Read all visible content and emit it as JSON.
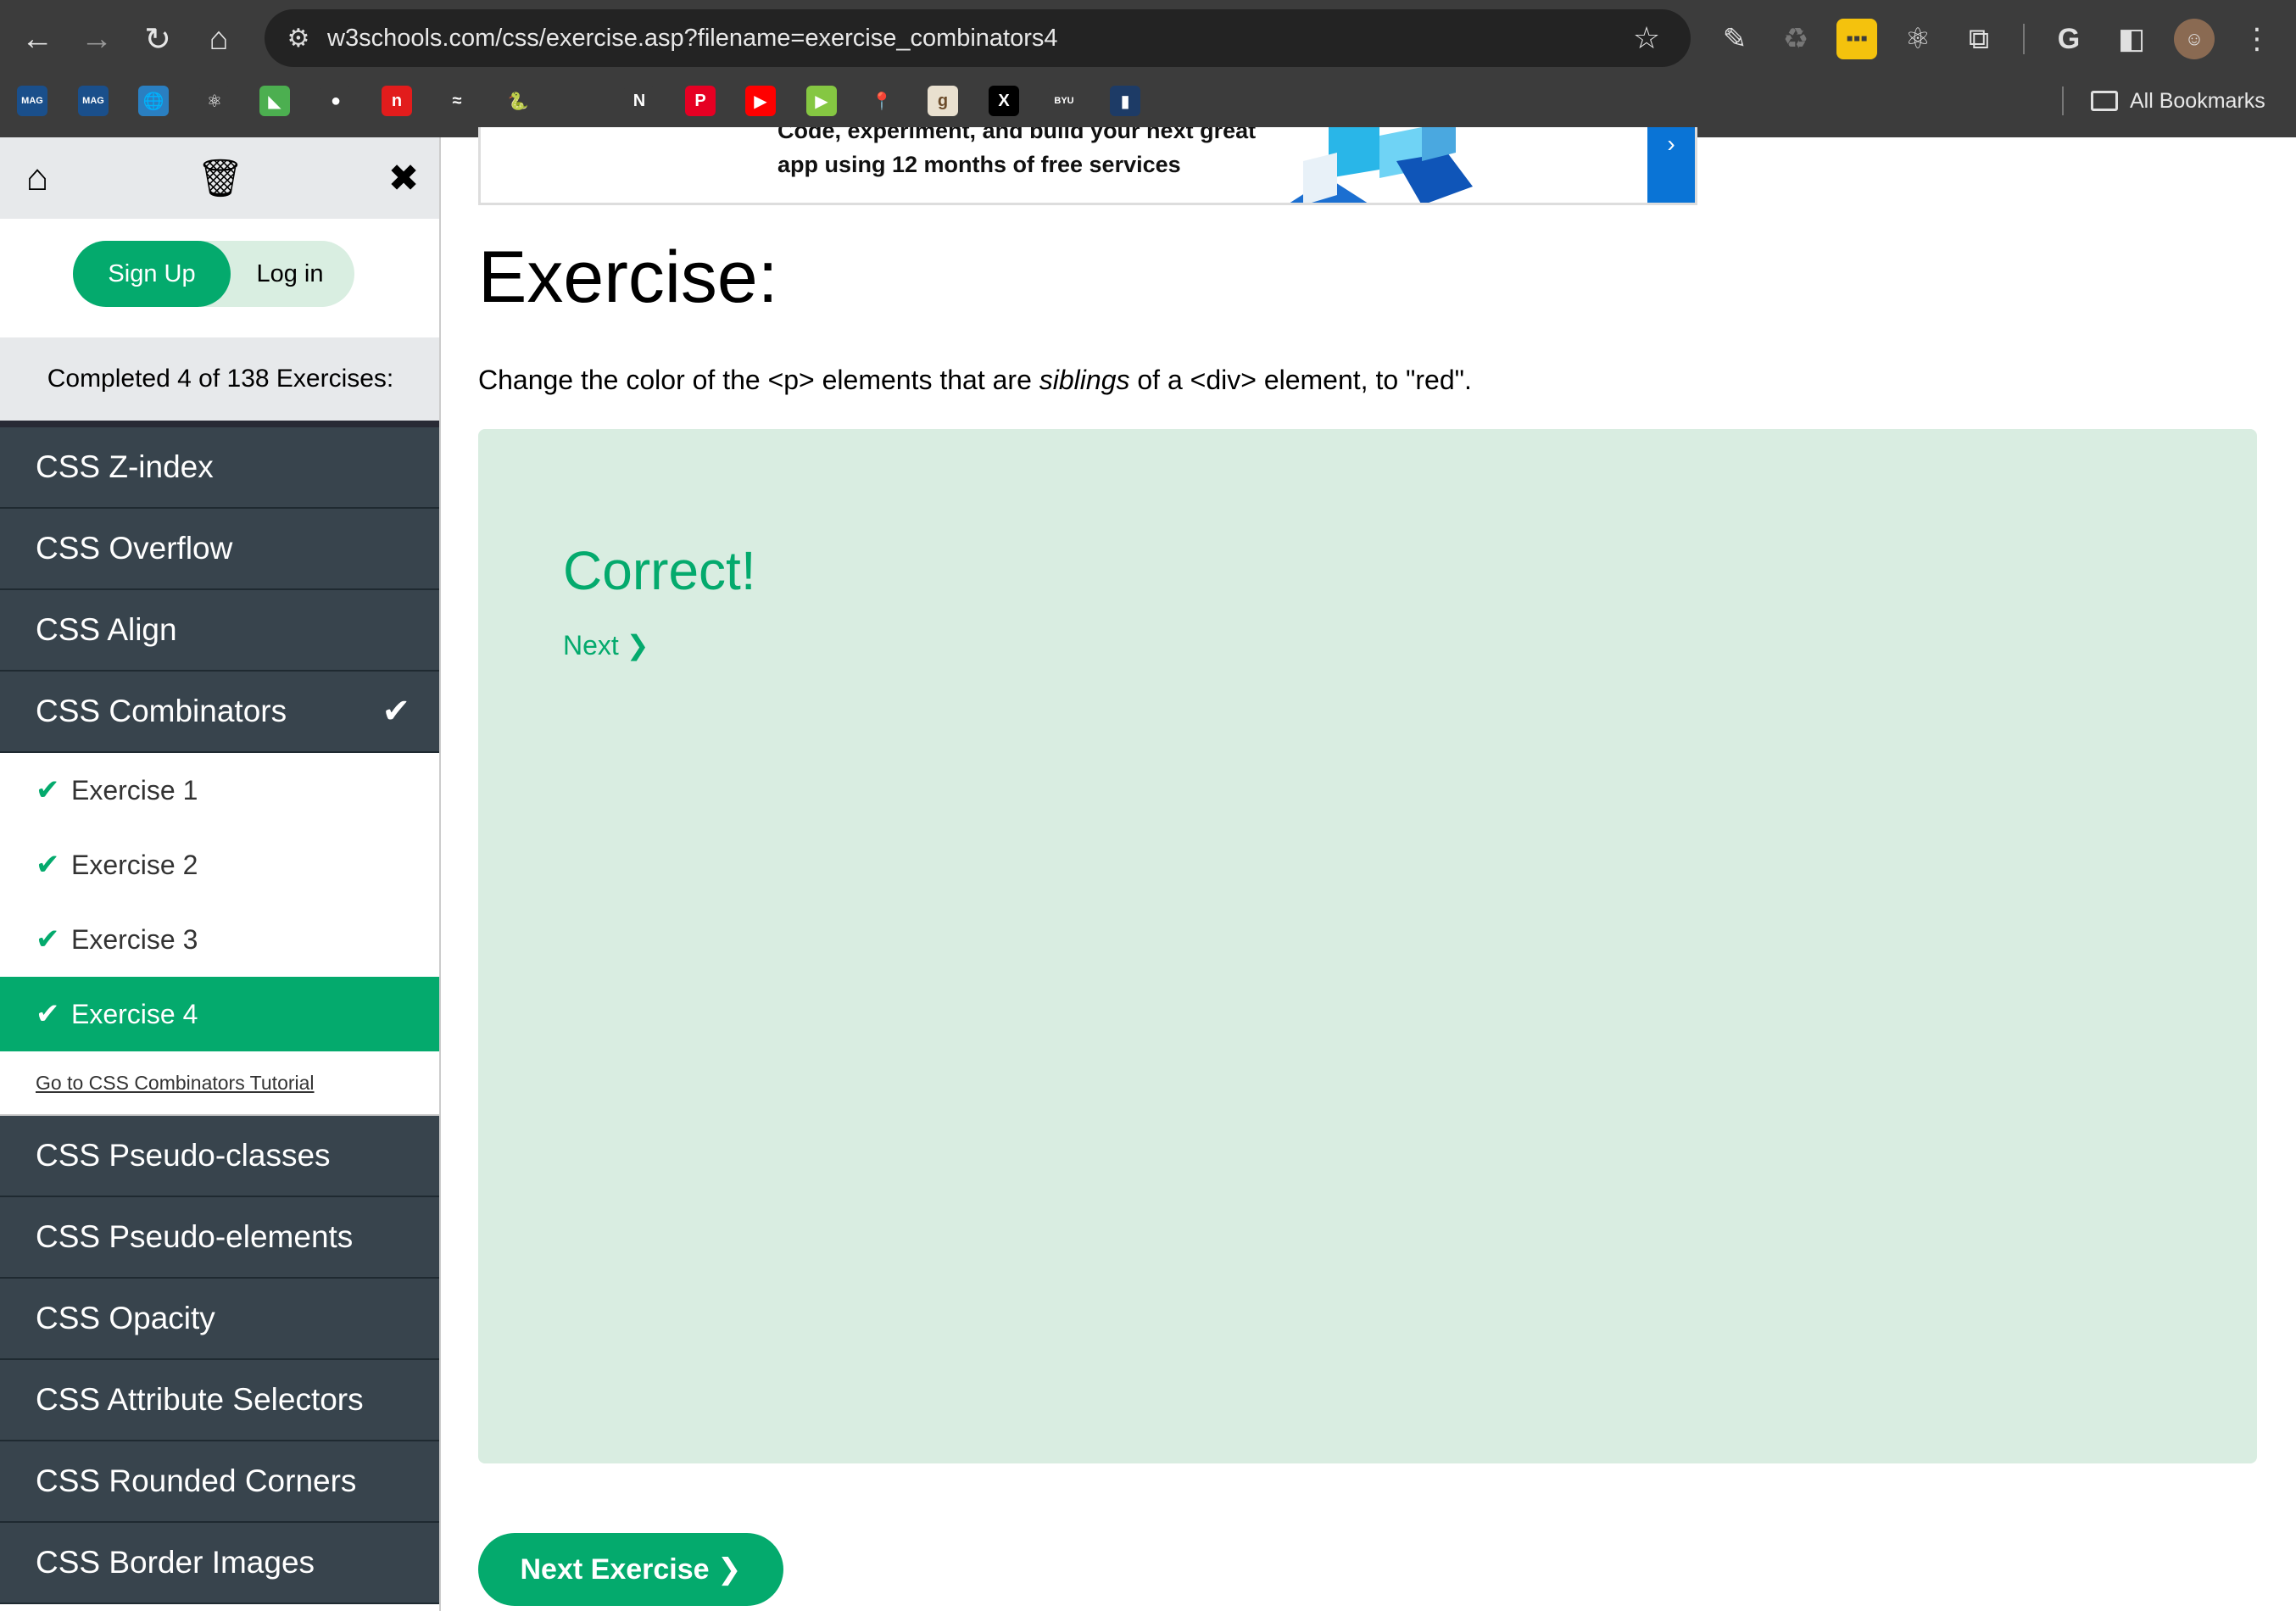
{
  "browser": {
    "url": "w3schools.com/css/exercise.asp?filename=exercise_combinators4",
    "all_bookmarks_label": "All Bookmarks",
    "bookmarks": [
      {
        "icon": "mag-icon",
        "color": "#1a4f8b",
        "glyph": "MAG"
      },
      {
        "icon": "mag-icon",
        "color": "#1a4f8b",
        "glyph": "MAG"
      },
      {
        "icon": "globe-icon",
        "color": "#2a7fc1",
        "glyph": "🌐"
      },
      {
        "icon": "react-icon",
        "color": "#3c3c3c",
        "glyph": "⚛"
      },
      {
        "icon": "leaf-icon",
        "color": "#4caf50",
        "glyph": "◣"
      },
      {
        "icon": "github-icon",
        "color": "#3c3c3c",
        "glyph": "●"
      },
      {
        "icon": "n-icon",
        "color": "#e21c1c",
        "glyph": "n"
      },
      {
        "icon": "tailwind-icon",
        "color": "#3c3c3c",
        "glyph": "≈"
      },
      {
        "icon": "python-icon",
        "color": "#3c3c3c",
        "glyph": "🐍"
      },
      {
        "icon": "apple-icon",
        "color": "#3c3c3c",
        "glyph": ""
      },
      {
        "icon": "netflix-icon",
        "color": "#3c3c3c",
        "glyph": "N"
      },
      {
        "icon": "pinterest-icon",
        "color": "#e60023",
        "glyph": "P"
      },
      {
        "icon": "youtube-icon",
        "color": "#ff0000",
        "glyph": "▶"
      },
      {
        "icon": "rumble-icon",
        "color": "#85c742",
        "glyph": "▶"
      },
      {
        "icon": "maps-icon",
        "color": "#3c3c3c",
        "glyph": "📍"
      },
      {
        "icon": "goodreads-icon",
        "color": "#e9e0cf",
        "glyph": "g"
      },
      {
        "icon": "x-icon",
        "color": "#000000",
        "glyph": "X"
      },
      {
        "icon": "byu-icon",
        "color": "#3c3c3c",
        "glyph": "BYU"
      },
      {
        "icon": "bookmark-icon",
        "color": "#1d3b66",
        "glyph": "▮"
      }
    ]
  },
  "sidebar": {
    "signup_label": "Sign Up",
    "login_label": "Log in",
    "progress_text": "Completed 4 of 138 Exercises:",
    "menu_before": [
      "CSS Z-index",
      "CSS Overflow",
      "CSS Align"
    ],
    "active_menu": "CSS Combinators",
    "exercises": [
      "Exercise 1",
      "Exercise 2",
      "Exercise 3",
      "Exercise 4"
    ],
    "active_exercise_index": 3,
    "tutorial_link": "Go to CSS Combinators Tutorial",
    "menu_after": [
      "CSS Pseudo-classes",
      "CSS Pseudo-elements",
      "CSS Opacity",
      "CSS Attribute Selectors",
      "CSS Rounded Corners",
      "CSS Border Images"
    ]
  },
  "ad": {
    "line1": "Code, experiment, and build your next great",
    "line2": "app using 12 months of free services"
  },
  "main": {
    "title": "Exercise:",
    "desc_part1": "Change the color of the <p> elements that are ",
    "desc_em": "siblings",
    "desc_part2": " of a <div> element, to \"red\".",
    "result": "Correct!",
    "next_link": "Next ❯",
    "next_exercise_button": "Next Exercise ❯"
  },
  "colors": {
    "accent": "#04aa6d",
    "sidebar_menu": "#38444d",
    "result_bg": "#d9ede1"
  }
}
